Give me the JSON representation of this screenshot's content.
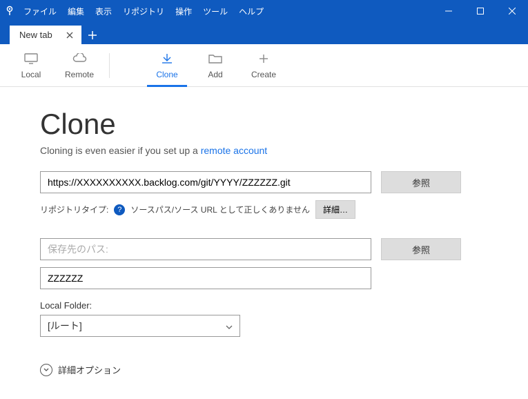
{
  "menu": {
    "items": [
      "ファイル",
      "編集",
      "表示",
      "リポジトリ",
      "操作",
      "ツール",
      "ヘルプ"
    ]
  },
  "tabs": {
    "active": {
      "label": "New tab"
    }
  },
  "toolbar": {
    "local": "Local",
    "remote": "Remote",
    "clone": "Clone",
    "add": "Add",
    "create": "Create"
  },
  "page": {
    "title": "Clone",
    "subtitle_prefix": "Cloning is even easier if you set up a ",
    "subtitle_link": "remote account",
    "url_value": "https://XXXXXXXXXX.backlog.com/git/YYYY/ZZZZZZ.git",
    "browse": "参照",
    "repo_type_label": "リポジトリタイプ:",
    "repo_type_msg": "ソースパス/ソース URL として正しくありません",
    "details_btn": "詳細…",
    "dest_placeholder": "保存先のパス:",
    "name_value": "ZZZZZZ",
    "local_folder_label": "Local Folder:",
    "local_folder_value": "[ルート]",
    "advanced": "詳細オプション"
  }
}
